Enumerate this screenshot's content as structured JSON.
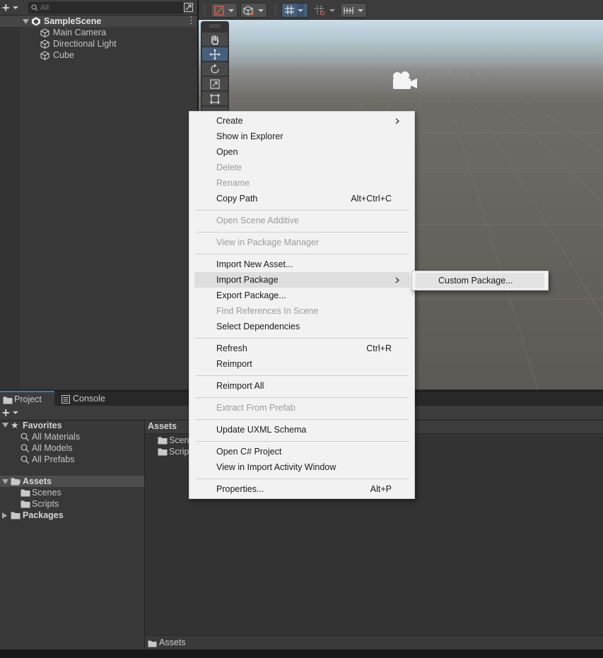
{
  "hierarchy": {
    "add_label": "+",
    "search": {
      "placeholder": "All",
      "value": ""
    },
    "scene_name": "SampleScene",
    "items": [
      {
        "label": "Main Camera",
        "icon": "gameobject-cube-icon"
      },
      {
        "label": "Directional Light",
        "icon": "gameobject-cube-icon"
      },
      {
        "label": "Cube",
        "icon": "gameobject-cube-icon"
      }
    ]
  },
  "scene_toolbar": {
    "buttons": [
      "gizmo-orientation",
      "draw-mode",
      "grid-snapping",
      "increment-snap",
      "render-layers"
    ]
  },
  "scene_tools": [
    "hand",
    "move",
    "rotate",
    "scale",
    "rect",
    "transform"
  ],
  "context_menu": {
    "items": [
      {
        "label": "Create",
        "submenu": true
      },
      {
        "label": "Show in Explorer"
      },
      {
        "label": "Open"
      },
      {
        "label": "Delete",
        "disabled": true
      },
      {
        "label": "Rename",
        "disabled": true
      },
      {
        "label": "Copy Path",
        "shortcut": "Alt+Ctrl+C"
      },
      {
        "label": "Open Scene Additive",
        "disabled": true
      },
      {
        "label": "View in Package Manager",
        "disabled": true
      },
      {
        "label": "Import New Asset..."
      },
      {
        "label": "Import Package",
        "submenu": true,
        "highlighted": true
      },
      {
        "label": "Export Package..."
      },
      {
        "label": "Find References In Scene",
        "disabled": true
      },
      {
        "label": "Select Dependencies"
      },
      {
        "label": "Refresh",
        "shortcut": "Ctrl+R"
      },
      {
        "label": "Reimport"
      },
      {
        "label": "Reimport All"
      },
      {
        "label": "Extract From Prefab",
        "disabled": true
      },
      {
        "label": "Update UXML Schema"
      },
      {
        "label": "Open C# Project"
      },
      {
        "label": "View in Import Activity Window"
      },
      {
        "label": "Properties...",
        "shortcut": "Alt+P"
      }
    ],
    "submenu": {
      "label": "Custom Package..."
    }
  },
  "bottom": {
    "tabs": [
      {
        "label": "Project",
        "active": true
      },
      {
        "label": "Console",
        "active": false
      }
    ],
    "add_label": "+",
    "favorites": {
      "label": "Favorites",
      "items": [
        "All Materials",
        "All Models",
        "All Prefabs"
      ]
    },
    "assets_tree": {
      "label": "Assets",
      "children": [
        "Scenes",
        "Scripts"
      ]
    },
    "packages_label": "Packages",
    "assets_header": "Assets",
    "assets_items": [
      "Scen",
      "Scrip"
    ],
    "path_bar": "Assets"
  }
}
